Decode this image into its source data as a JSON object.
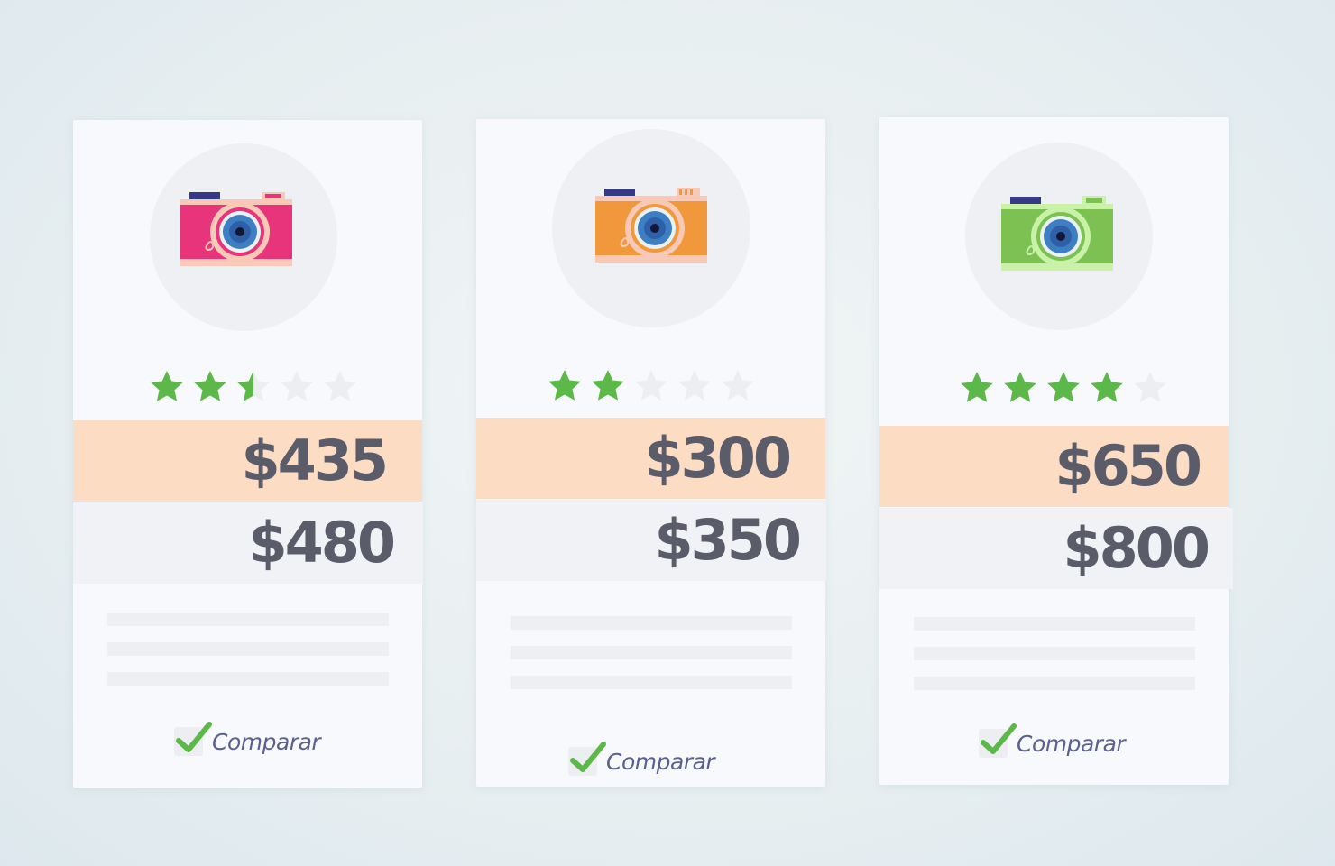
{
  "colors": {
    "star_filled": "#5cb848",
    "star_empty": "#eceef2",
    "sale_band": "#fcdcc2",
    "original_band": "#f1f2f6",
    "price_text": "#5a5c6a",
    "compare_text": "#5b6090",
    "check": "#5cb848"
  },
  "products": [
    {
      "camera_color": "#e8347a",
      "camera_icon": "pink-camera-icon",
      "rating": 2.5,
      "max_rating": 5,
      "sale_price": "$435",
      "original_price": "$480",
      "compare_label": "Comparar",
      "compare_checked": true
    },
    {
      "camera_color": "#f2983c",
      "camera_icon": "orange-camera-icon",
      "rating": 2,
      "max_rating": 5,
      "sale_price": "$300",
      "original_price": "$350",
      "compare_label": "Comparar",
      "compare_checked": true
    },
    {
      "camera_color": "#7cc152",
      "camera_icon": "green-camera-icon",
      "rating": 4,
      "max_rating": 5,
      "sale_price": "$650",
      "original_price": "$800",
      "compare_label": "Comparar",
      "compare_checked": true
    }
  ]
}
